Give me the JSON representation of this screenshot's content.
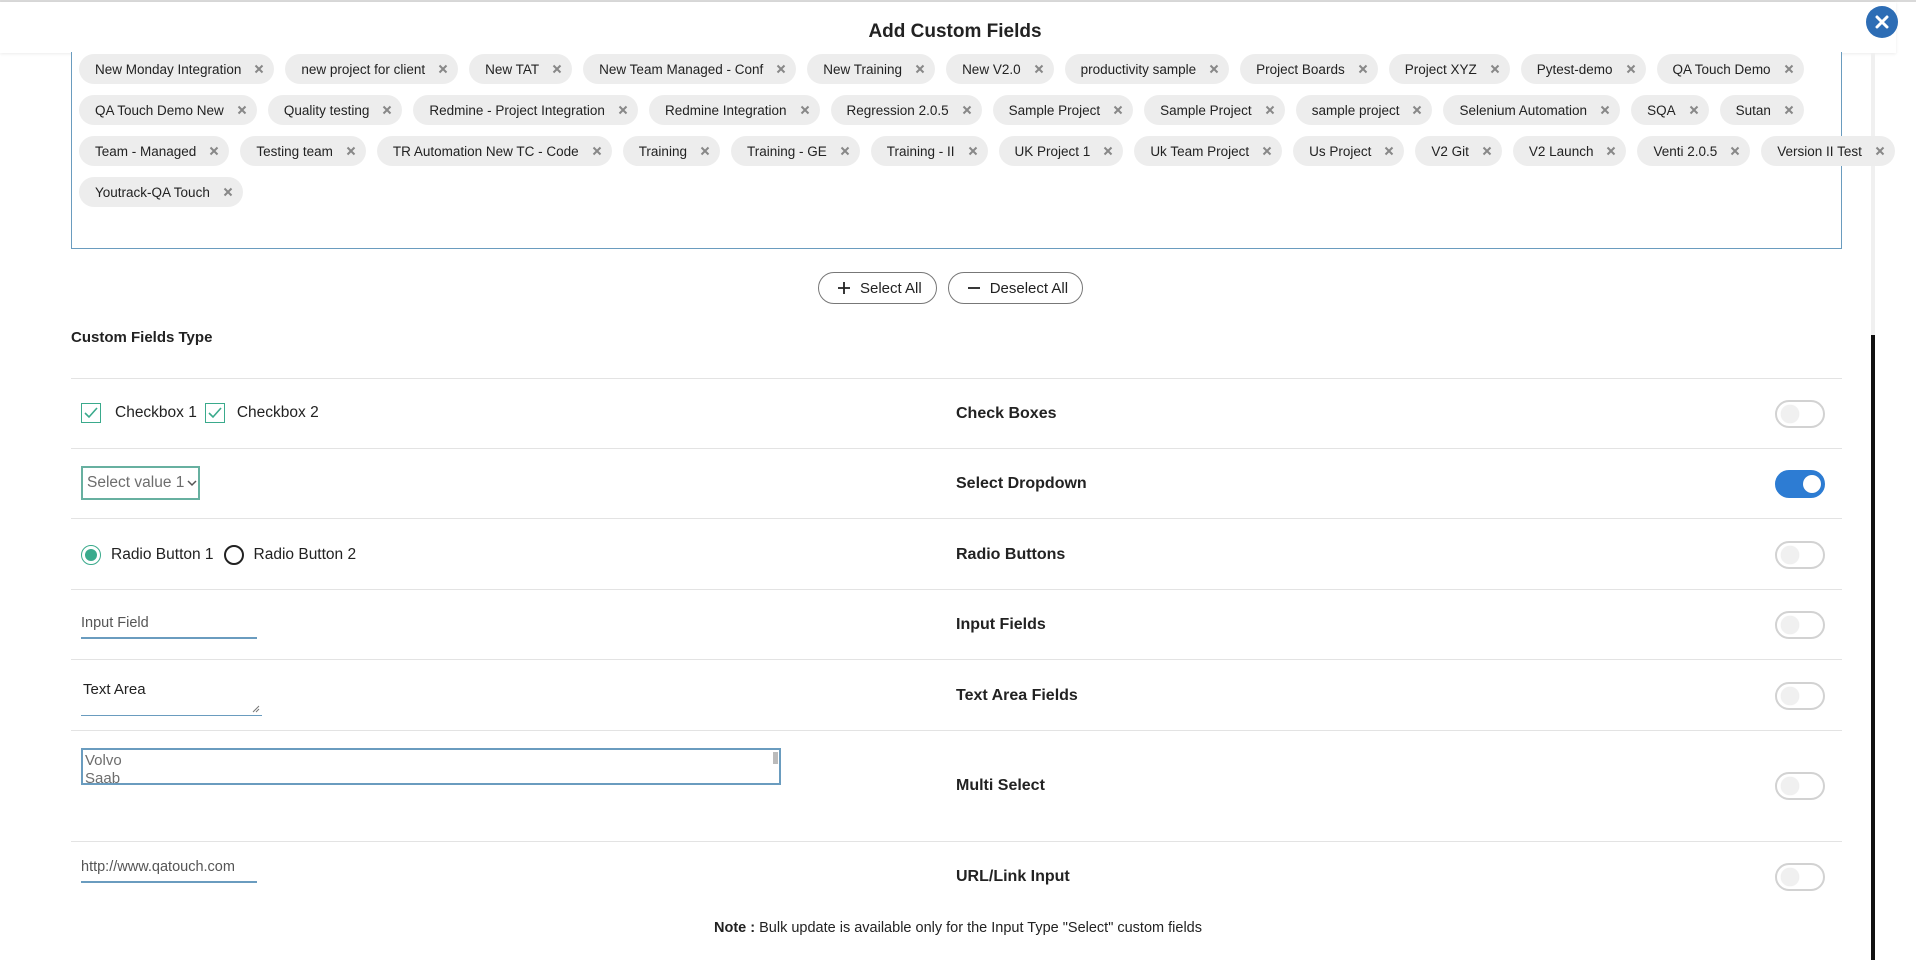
{
  "modal": {
    "title": "Add Custom Fields",
    "close_icon": "close-icon"
  },
  "projects": {
    "rows": [
      [
        "New Monday Integration",
        "new project for client",
        "New TAT",
        "New Team Managed - Conf",
        "New Training",
        "New V2.0",
        "productivity sample",
        "Project Boards",
        "Project XYZ",
        "Pytest-demo",
        "QA Touch Demo"
      ],
      [
        "QA Touch Demo New",
        "Quality testing",
        "Redmine - Project Integration",
        "Redmine Integration",
        "Regression 2.0.5",
        "Sample Project",
        "Sample Project",
        "sample project",
        "Selenium Automation",
        "SQA",
        "Sutan"
      ],
      [
        "Team - Managed",
        "Testing team",
        "TR Automation New TC - Code",
        "Training",
        "Training - GE",
        "Training - II",
        "UK Project 1",
        "Uk Team Project",
        "Us Project",
        "V2 Git",
        "V2 Launch",
        "Venti 2.0.5",
        "Version II Test"
      ],
      [
        "Youtrack-QA Touch"
      ]
    ]
  },
  "actions": {
    "select_all": "Select All",
    "deselect_all": "Deselect All"
  },
  "section": {
    "title": "Custom Fields Type"
  },
  "fields": {
    "checkbox": {
      "opt1": "Checkbox 1",
      "opt2": "Checkbox 2",
      "label": "Check Boxes",
      "enabled": false
    },
    "select": {
      "value": "Select value 1",
      "label": "Select Dropdown",
      "enabled": true
    },
    "radio": {
      "opt1": "Radio Button 1",
      "opt2": "Radio Button 2",
      "label": "Radio Buttons",
      "enabled": false
    },
    "input": {
      "placeholder": "Input Field",
      "label": "Input Fields",
      "enabled": false
    },
    "textarea": {
      "value": "Text Area",
      "label": "Text Area Fields",
      "enabled": false
    },
    "multiselect": {
      "options": [
        "Volvo",
        "Saab"
      ],
      "label": "Multi Select",
      "enabled": false
    },
    "url": {
      "placeholder": "http://www.qatouch.com",
      "label": "URL/Link Input",
      "enabled": false
    }
  },
  "note": {
    "prefix": "Note :",
    "text": "Bulk update is available only for the Input Type \"Select\" custom fields"
  },
  "colors": {
    "accent_blue": "#2d7cd3",
    "check_green": "#3aaa8c",
    "border_blue": "#6a9cbf"
  }
}
